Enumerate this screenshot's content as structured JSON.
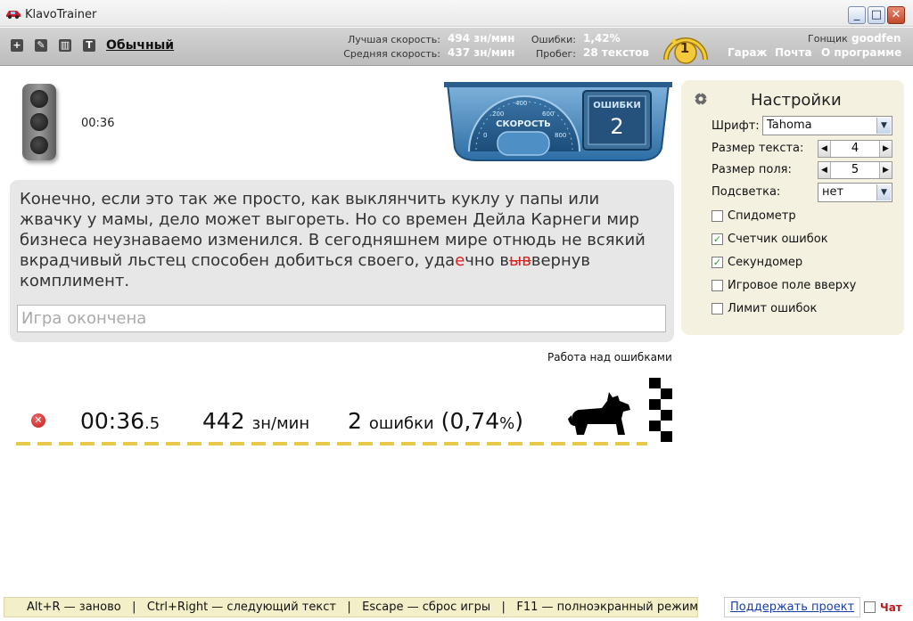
{
  "window": {
    "title": "KlavoTrainer"
  },
  "topbar": {
    "mode": "Обычный",
    "best_speed_label": "Лучшая скорость:",
    "best_speed_value": "494 зн/мин",
    "avg_speed_label": "Средняя скорость:",
    "avg_speed_value": "437 зн/мин",
    "errors_label": "Ошибки:",
    "errors_value": "1,42%",
    "mileage_label": "Пробег:",
    "mileage_value": "28 текстов",
    "rank": "1",
    "racer_label": "Гонщик",
    "racer_name": "goodfen",
    "nav": [
      "Гараж",
      "Почта",
      "О программе"
    ],
    "icons": [
      "plus-icon",
      "edit-icon",
      "chart-icon",
      "text-icon"
    ]
  },
  "race": {
    "timer": "00:36",
    "speed_label": "СКОРОСТЬ",
    "error_label": "ОШИБКИ",
    "error_count": "2",
    "speed_ticks": [
      "0",
      "200",
      "400",
      "600",
      "800"
    ]
  },
  "text": {
    "part1": "Конечно, если это так же просто, как выклянчить куклу у папы или жвачку у мамы, дело может выгореть. Но со времен Дейла Карнеги мир бизнеса неузнаваемо изменился. В сегодняшнем мире отнюдь не всякий вкрадчивый льстец способен добиться своего, уда",
    "err1": "е",
    "part2": "чно в",
    "err2": "ыв",
    "part3": "вернув комплимент."
  },
  "input": {
    "placeholder": "Игра окончена"
  },
  "error_work_link": "Работа над ошибками",
  "result": {
    "time_main": "00:36",
    "time_frac": ".5",
    "speed": "442",
    "speed_unit": "зн/мин",
    "errors_count": "2",
    "errors_word": "ошибки",
    "errors_open": "(",
    "errors_percent": "0,74",
    "errors_pct_sign": "%",
    "errors_close": ")"
  },
  "settings": {
    "title": "Настройки",
    "font_label": "Шрифт:",
    "font_value": "Tahoma",
    "text_size_label": "Размер текста:",
    "text_size_value": "4",
    "field_size_label": "Размер поля:",
    "field_size_value": "5",
    "highlight_label": "Подсветка:",
    "highlight_value": "нет",
    "checkboxes": [
      {
        "label": "Спидометр",
        "checked": false
      },
      {
        "label": "Счетчик ошибок",
        "checked": true
      },
      {
        "label": "Секундомер",
        "checked": true
      },
      {
        "label": "Игровое поле вверху",
        "checked": false
      },
      {
        "label": "Лимит ошибок",
        "checked": false
      }
    ]
  },
  "hints": {
    "text": "Alt+R — заново   |   Ctrl+Right — следующий текст   |   Escape — сброс игры   |   F11 — полноэкранный режим",
    "support": "Поддержать проект",
    "chat": "Чат"
  },
  "colors": {
    "accent_yellow": "#e8c94a",
    "error_red": "#d8201c",
    "panel_bg": "#e7e7e7",
    "settings_bg": "#f4f1e1"
  }
}
